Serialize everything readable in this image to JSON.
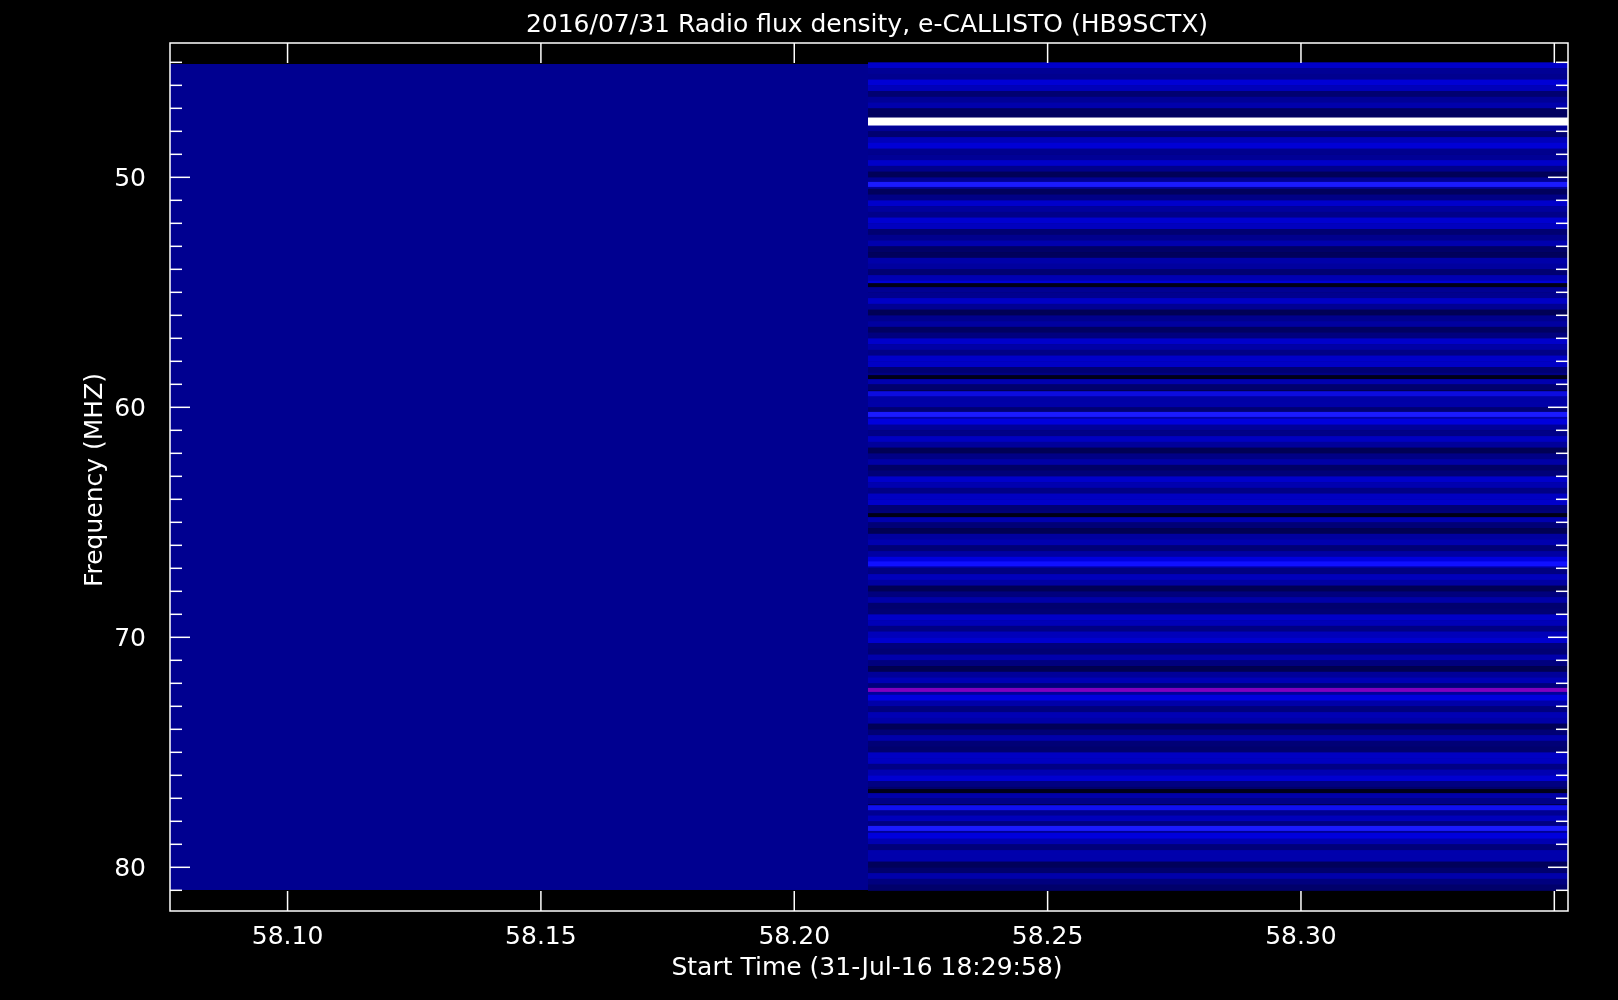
{
  "title": "2016/07/31  Radio flux density, e-CALLISTO (HB9SCTX)",
  "x_axis": {
    "label": "Start Time (31-Jul-16 18:29:58)",
    "ticks": [
      "58.10",
      "58.15",
      "58.20",
      "58.25",
      "58.30"
    ]
  },
  "y_axis": {
    "label": "Frequency (MHZ)",
    "ticks": [
      "50",
      "60",
      "70",
      "80"
    ]
  }
}
